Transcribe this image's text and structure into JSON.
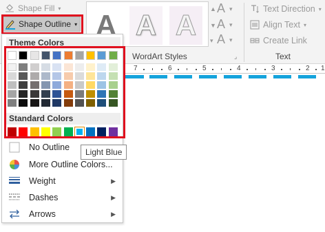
{
  "ribbon": {
    "shape_fill_label": "Shape Fill",
    "shape_outline_label": "Shape Outline",
    "wordart_glyph": "A",
    "wordart_group_label": "WordArt Styles",
    "text_group_label": "Text",
    "text_direction_label": "Text Direction",
    "align_text_label": "Align Text",
    "create_link_label": "Create Link"
  },
  "ruler": {
    "labels": [
      "7",
      "6",
      "5",
      "4",
      "3",
      "2",
      "1"
    ]
  },
  "dropdown": {
    "theme_colors_label": "Theme Colors",
    "standard_colors_label": "Standard Colors",
    "theme_colors_top": [
      "#ffffff",
      "#000000",
      "#e7e6e6",
      "#44546a",
      "#4472c4",
      "#ed7d31",
      "#a5a5a5",
      "#ffc000",
      "#5b9bd5",
      "#70ad47"
    ],
    "theme_shades": [
      [
        "#f2f2f2",
        "#7f7f7f",
        "#d0cece",
        "#d6dce4",
        "#d9e2f3",
        "#fbe5d5",
        "#ededed",
        "#fff2cc",
        "#deebf6",
        "#e2efd9"
      ],
      [
        "#d8d8d8",
        "#595959",
        "#aeabab",
        "#adb9ca",
        "#b4c6e7",
        "#f7cbac",
        "#dbdbdb",
        "#fee599",
        "#bdd7ee",
        "#c5e0b3"
      ],
      [
        "#bfbfbf",
        "#3f3f3f",
        "#757070",
        "#8496b0",
        "#8eaadb",
        "#f4b183",
        "#c9c9c9",
        "#ffd965",
        "#9cc3e5",
        "#a8d08d"
      ],
      [
        "#a5a5a5",
        "#262626",
        "#3a3838",
        "#323f4f",
        "#2f5496",
        "#c55a11",
        "#7b7b7b",
        "#bf9000",
        "#2e75b5",
        "#538135"
      ],
      [
        "#7f7f7f",
        "#0c0c0c",
        "#171616",
        "#222a35",
        "#1f3864",
        "#833c0b",
        "#525252",
        "#7f6000",
        "#1e4e79",
        "#375623"
      ]
    ],
    "standard_colors": [
      "#c00000",
      "#ff0000",
      "#ffc000",
      "#ffff00",
      "#92d050",
      "#00b050",
      "#00b0f0",
      "#0070c0",
      "#002060",
      "#7030a0"
    ],
    "no_outline_label": "No Outline",
    "more_outline_colors_label": "More Outline Colors...",
    "weight_label": "Weight",
    "dashes_label": "Dashes",
    "arrows_label": "Arrows"
  },
  "tooltip": {
    "text": "Light Blue"
  },
  "colors": {
    "highlight_red": "#e0101e",
    "outline_color": "#14a3dc",
    "selected_swatch_border": "#e08a00"
  }
}
